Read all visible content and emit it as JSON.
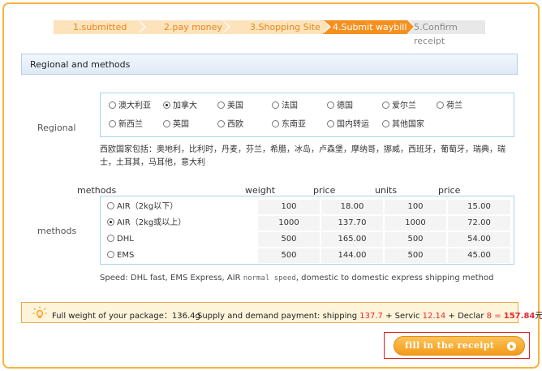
{
  "steps": [
    {
      "label": "1.submitted"
    },
    {
      "label": "2.pay money"
    },
    {
      "label": "3.Shopping Site"
    },
    {
      "label": "4.Submit waybill"
    },
    {
      "label": "5.Confirm receipt"
    }
  ],
  "section": {
    "title": "Regional and methods"
  },
  "regional": {
    "label": "Regional",
    "options": [
      "澳大利亚",
      "加拿大",
      "美国",
      "法国",
      "德国",
      "爱尔兰",
      "荷兰",
      "新西兰",
      "英国",
      "西欧",
      "东南亚",
      "国内转运",
      "其他国家"
    ],
    "selected": "加拿大",
    "note": "西欧国家包括：奥地利，比利时，丹麦，芬兰，希腊，冰岛，卢森堡，摩纳哥，挪威，西班牙，葡萄牙，瑞典，瑞士，土耳其，马耳他，意大利"
  },
  "methods": {
    "label": "methods",
    "headers": {
      "method": "methods",
      "weight": "weight",
      "price": "price",
      "units": "units",
      "price2": "price"
    },
    "rows": [
      {
        "name": "AIR（2kg以下）",
        "weight": "100",
        "price": "18.00",
        "units": "100",
        "price2": "15.00",
        "selected": false
      },
      {
        "name": "AIR（2kg或以上）",
        "weight": "1000",
        "price": "137.70",
        "units": "1000",
        "price2": "72.00",
        "selected": true
      },
      {
        "name": "DHL",
        "weight": "500",
        "price": "165.00",
        "units": "500",
        "price2": "54.00",
        "selected": false
      },
      {
        "name": "EMS",
        "weight": "500",
        "price": "144.00",
        "units": "500",
        "price2": "45.00",
        "selected": false
      }
    ],
    "speed_prefix": "Speed: DHL fast, EMS Express, AIR ",
    "speed_mono": "normal speed",
    "speed_suffix": ", domestic to domestic express shipping method"
  },
  "summary": {
    "weight_label": "Full weight of your package：",
    "weight_value": "136.4g",
    "payment_label": "Supply and demand payment: shipping",
    "shipping": "137.7",
    "plus1": "+",
    "servic_label": "Servic",
    "servic": "12.14",
    "plus2": "+",
    "declar_label": "Declar",
    "declar": "8",
    "eq": "=",
    "total": "157.84",
    "currency": "元"
  },
  "button": {
    "label": "fill in the receipt"
  },
  "colors": {
    "accent": "#f5901e",
    "frame": "#f7b43a",
    "red": "#e6282f",
    "blue_border": "#a9d4ec"
  }
}
